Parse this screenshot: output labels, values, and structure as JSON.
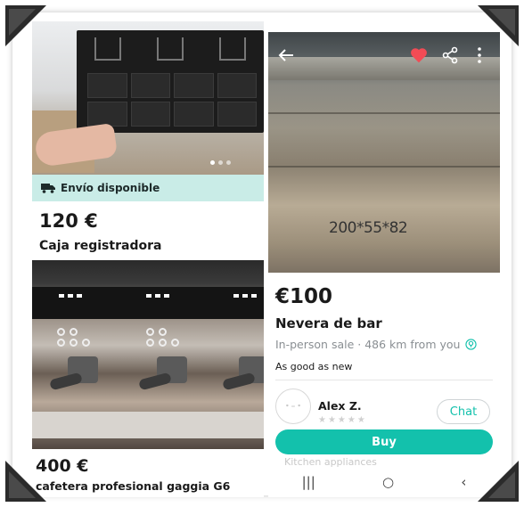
{
  "left_listings": [
    {
      "shipping_label": "Envío disponible",
      "price": "120 €",
      "title": "Caja registradora"
    },
    {
      "price": "400 €",
      "title": "cafetera profesional gaggia G6"
    }
  ],
  "detail": {
    "photo_caption": "200*55*82",
    "price": "€100",
    "title": "Nevera de bar",
    "location": "In-person sale · 486 km from you",
    "condition": "As good as new",
    "seller": {
      "name": "Alex Z.",
      "stars": "★★★★★"
    },
    "chat_label": "Chat",
    "buy_label": "Buy",
    "category_peek": "Kitchen appliances"
  },
  "icons": {
    "back": "back-arrow-icon",
    "favorite": "heart-icon",
    "share": "share-icon",
    "more": "more-vertical-icon",
    "shipping": "truck-icon",
    "location": "location-pin-icon"
  },
  "nav": {
    "recents": "|||",
    "home": "○",
    "back": "‹"
  },
  "colors": {
    "accent": "#13c1ac",
    "shipping_bg": "#c9ece7",
    "heart": "#f24b55"
  }
}
